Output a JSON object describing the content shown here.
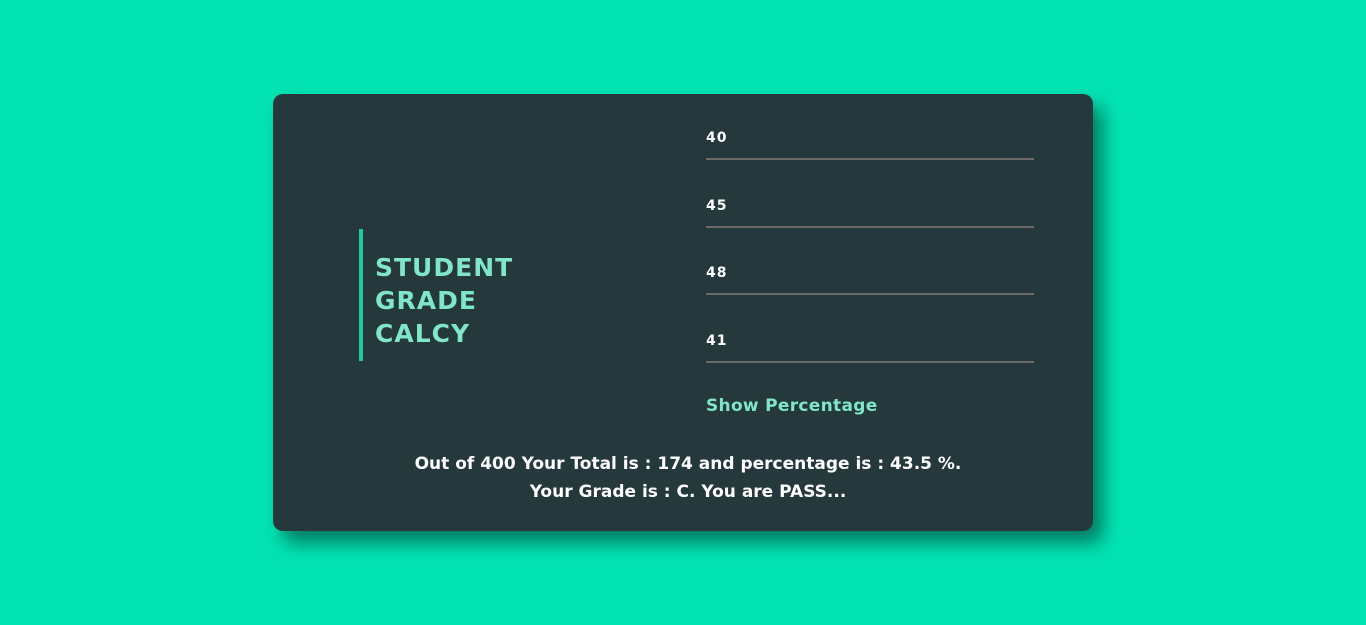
{
  "app": {
    "title_lines": [
      "STUDENT",
      "GRADE",
      "CALCY"
    ],
    "accent_color": "#1ecb9e",
    "background_color": "#02e3b3",
    "card_color": "#25383c"
  },
  "form": {
    "marks": [
      "40",
      "45",
      "48",
      "41"
    ],
    "button_label": "Show Percentage"
  },
  "result": {
    "line1": "Out of 400 Your Total is : 174 and percentage is : 43.5 %.",
    "line2": "Your Grade is : C. You are PASS..."
  }
}
